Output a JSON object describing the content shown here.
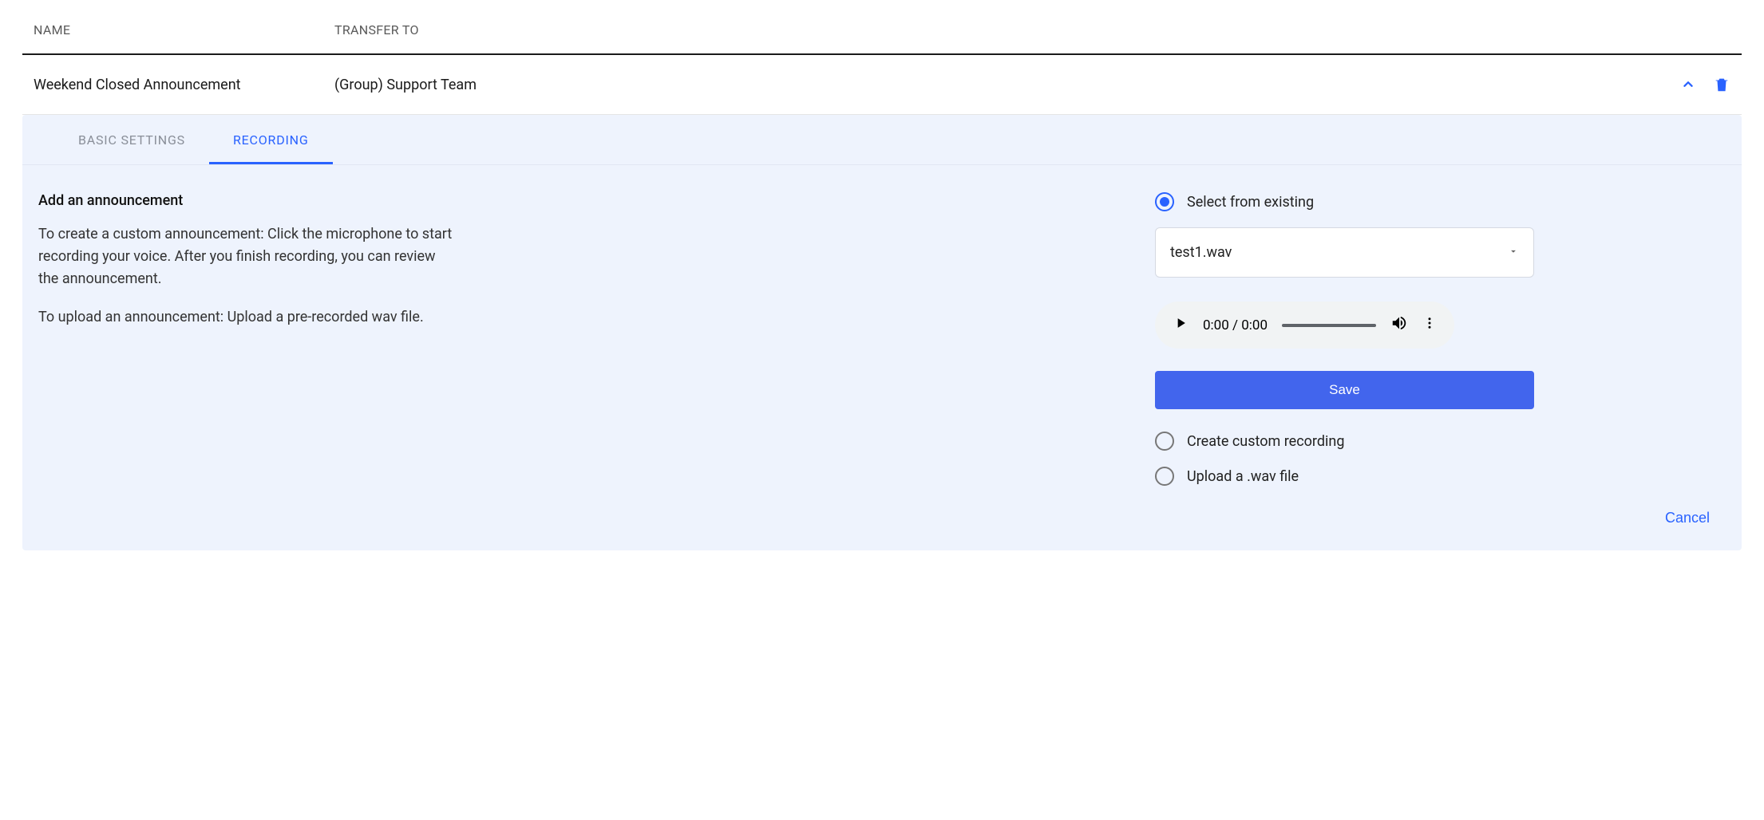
{
  "table": {
    "headers": {
      "name": "NAME",
      "transfer_to": "TRANSFER TO"
    },
    "row": {
      "name": "Weekend Closed Announcement",
      "transfer_to": "(Group) Support Team"
    }
  },
  "tabs": {
    "basic_settings": "BASIC SETTINGS",
    "recording": "RECORDING"
  },
  "panel": {
    "title": "Add an announcement",
    "desc1": "To create a custom announcement: Click the microphone to start recording your voice. After you finish recording, you can review the announcement.",
    "desc2": "To upload an announcement: Upload a pre-recorded wav file."
  },
  "options": {
    "select_existing": "Select from existing",
    "custom_recording": "Create custom recording",
    "upload_wav": "Upload a .wav file",
    "selected_file": "test1.wav"
  },
  "audio": {
    "time": "0:00 / 0:00"
  },
  "buttons": {
    "save": "Save",
    "cancel": "Cancel"
  }
}
